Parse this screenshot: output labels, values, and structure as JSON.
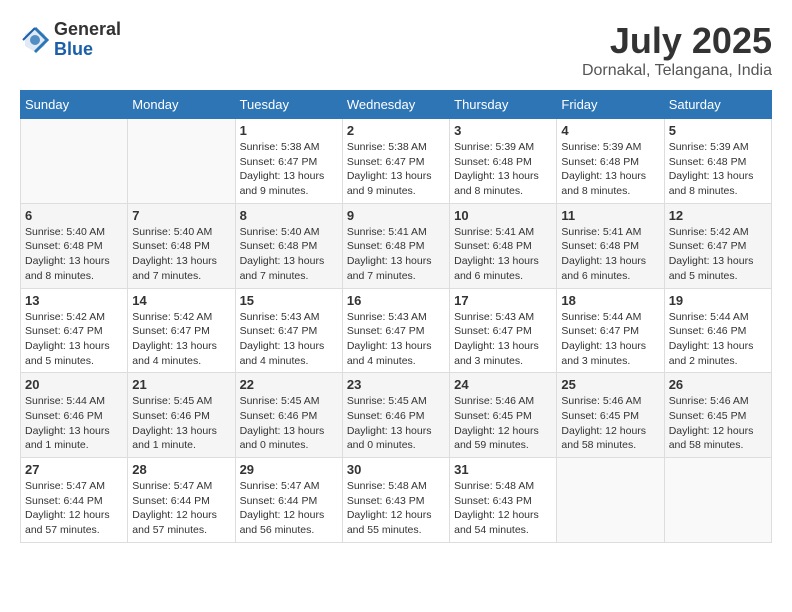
{
  "header": {
    "logo": {
      "general": "General",
      "blue": "Blue"
    },
    "month_year": "July 2025",
    "location": "Dornakal, Telangana, India"
  },
  "weekdays": [
    "Sunday",
    "Monday",
    "Tuesday",
    "Wednesday",
    "Thursday",
    "Friday",
    "Saturday"
  ],
  "weeks": [
    [
      {
        "day": "",
        "detail": ""
      },
      {
        "day": "",
        "detail": ""
      },
      {
        "day": "1",
        "detail": "Sunrise: 5:38 AM\nSunset: 6:47 PM\nDaylight: 13 hours\nand 9 minutes."
      },
      {
        "day": "2",
        "detail": "Sunrise: 5:38 AM\nSunset: 6:47 PM\nDaylight: 13 hours\nand 9 minutes."
      },
      {
        "day": "3",
        "detail": "Sunrise: 5:39 AM\nSunset: 6:48 PM\nDaylight: 13 hours\nand 8 minutes."
      },
      {
        "day": "4",
        "detail": "Sunrise: 5:39 AM\nSunset: 6:48 PM\nDaylight: 13 hours\nand 8 minutes."
      },
      {
        "day": "5",
        "detail": "Sunrise: 5:39 AM\nSunset: 6:48 PM\nDaylight: 13 hours\nand 8 minutes."
      }
    ],
    [
      {
        "day": "6",
        "detail": "Sunrise: 5:40 AM\nSunset: 6:48 PM\nDaylight: 13 hours\nand 8 minutes."
      },
      {
        "day": "7",
        "detail": "Sunrise: 5:40 AM\nSunset: 6:48 PM\nDaylight: 13 hours\nand 7 minutes."
      },
      {
        "day": "8",
        "detail": "Sunrise: 5:40 AM\nSunset: 6:48 PM\nDaylight: 13 hours\nand 7 minutes."
      },
      {
        "day": "9",
        "detail": "Sunrise: 5:41 AM\nSunset: 6:48 PM\nDaylight: 13 hours\nand 7 minutes."
      },
      {
        "day": "10",
        "detail": "Sunrise: 5:41 AM\nSunset: 6:48 PM\nDaylight: 13 hours\nand 6 minutes."
      },
      {
        "day": "11",
        "detail": "Sunrise: 5:41 AM\nSunset: 6:48 PM\nDaylight: 13 hours\nand 6 minutes."
      },
      {
        "day": "12",
        "detail": "Sunrise: 5:42 AM\nSunset: 6:47 PM\nDaylight: 13 hours\nand 5 minutes."
      }
    ],
    [
      {
        "day": "13",
        "detail": "Sunrise: 5:42 AM\nSunset: 6:47 PM\nDaylight: 13 hours\nand 5 minutes."
      },
      {
        "day": "14",
        "detail": "Sunrise: 5:42 AM\nSunset: 6:47 PM\nDaylight: 13 hours\nand 4 minutes."
      },
      {
        "day": "15",
        "detail": "Sunrise: 5:43 AM\nSunset: 6:47 PM\nDaylight: 13 hours\nand 4 minutes."
      },
      {
        "day": "16",
        "detail": "Sunrise: 5:43 AM\nSunset: 6:47 PM\nDaylight: 13 hours\nand 4 minutes."
      },
      {
        "day": "17",
        "detail": "Sunrise: 5:43 AM\nSunset: 6:47 PM\nDaylight: 13 hours\nand 3 minutes."
      },
      {
        "day": "18",
        "detail": "Sunrise: 5:44 AM\nSunset: 6:47 PM\nDaylight: 13 hours\nand 3 minutes."
      },
      {
        "day": "19",
        "detail": "Sunrise: 5:44 AM\nSunset: 6:46 PM\nDaylight: 13 hours\nand 2 minutes."
      }
    ],
    [
      {
        "day": "20",
        "detail": "Sunrise: 5:44 AM\nSunset: 6:46 PM\nDaylight: 13 hours\nand 1 minute."
      },
      {
        "day": "21",
        "detail": "Sunrise: 5:45 AM\nSunset: 6:46 PM\nDaylight: 13 hours\nand 1 minute."
      },
      {
        "day": "22",
        "detail": "Sunrise: 5:45 AM\nSunset: 6:46 PM\nDaylight: 13 hours\nand 0 minutes."
      },
      {
        "day": "23",
        "detail": "Sunrise: 5:45 AM\nSunset: 6:46 PM\nDaylight: 13 hours\nand 0 minutes."
      },
      {
        "day": "24",
        "detail": "Sunrise: 5:46 AM\nSunset: 6:45 PM\nDaylight: 12 hours\nand 59 minutes."
      },
      {
        "day": "25",
        "detail": "Sunrise: 5:46 AM\nSunset: 6:45 PM\nDaylight: 12 hours\nand 58 minutes."
      },
      {
        "day": "26",
        "detail": "Sunrise: 5:46 AM\nSunset: 6:45 PM\nDaylight: 12 hours\nand 58 minutes."
      }
    ],
    [
      {
        "day": "27",
        "detail": "Sunrise: 5:47 AM\nSunset: 6:44 PM\nDaylight: 12 hours\nand 57 minutes."
      },
      {
        "day": "28",
        "detail": "Sunrise: 5:47 AM\nSunset: 6:44 PM\nDaylight: 12 hours\nand 57 minutes."
      },
      {
        "day": "29",
        "detail": "Sunrise: 5:47 AM\nSunset: 6:44 PM\nDaylight: 12 hours\nand 56 minutes."
      },
      {
        "day": "30",
        "detail": "Sunrise: 5:48 AM\nSunset: 6:43 PM\nDaylight: 12 hours\nand 55 minutes."
      },
      {
        "day": "31",
        "detail": "Sunrise: 5:48 AM\nSunset: 6:43 PM\nDaylight: 12 hours\nand 54 minutes."
      },
      {
        "day": "",
        "detail": ""
      },
      {
        "day": "",
        "detail": ""
      }
    ]
  ]
}
